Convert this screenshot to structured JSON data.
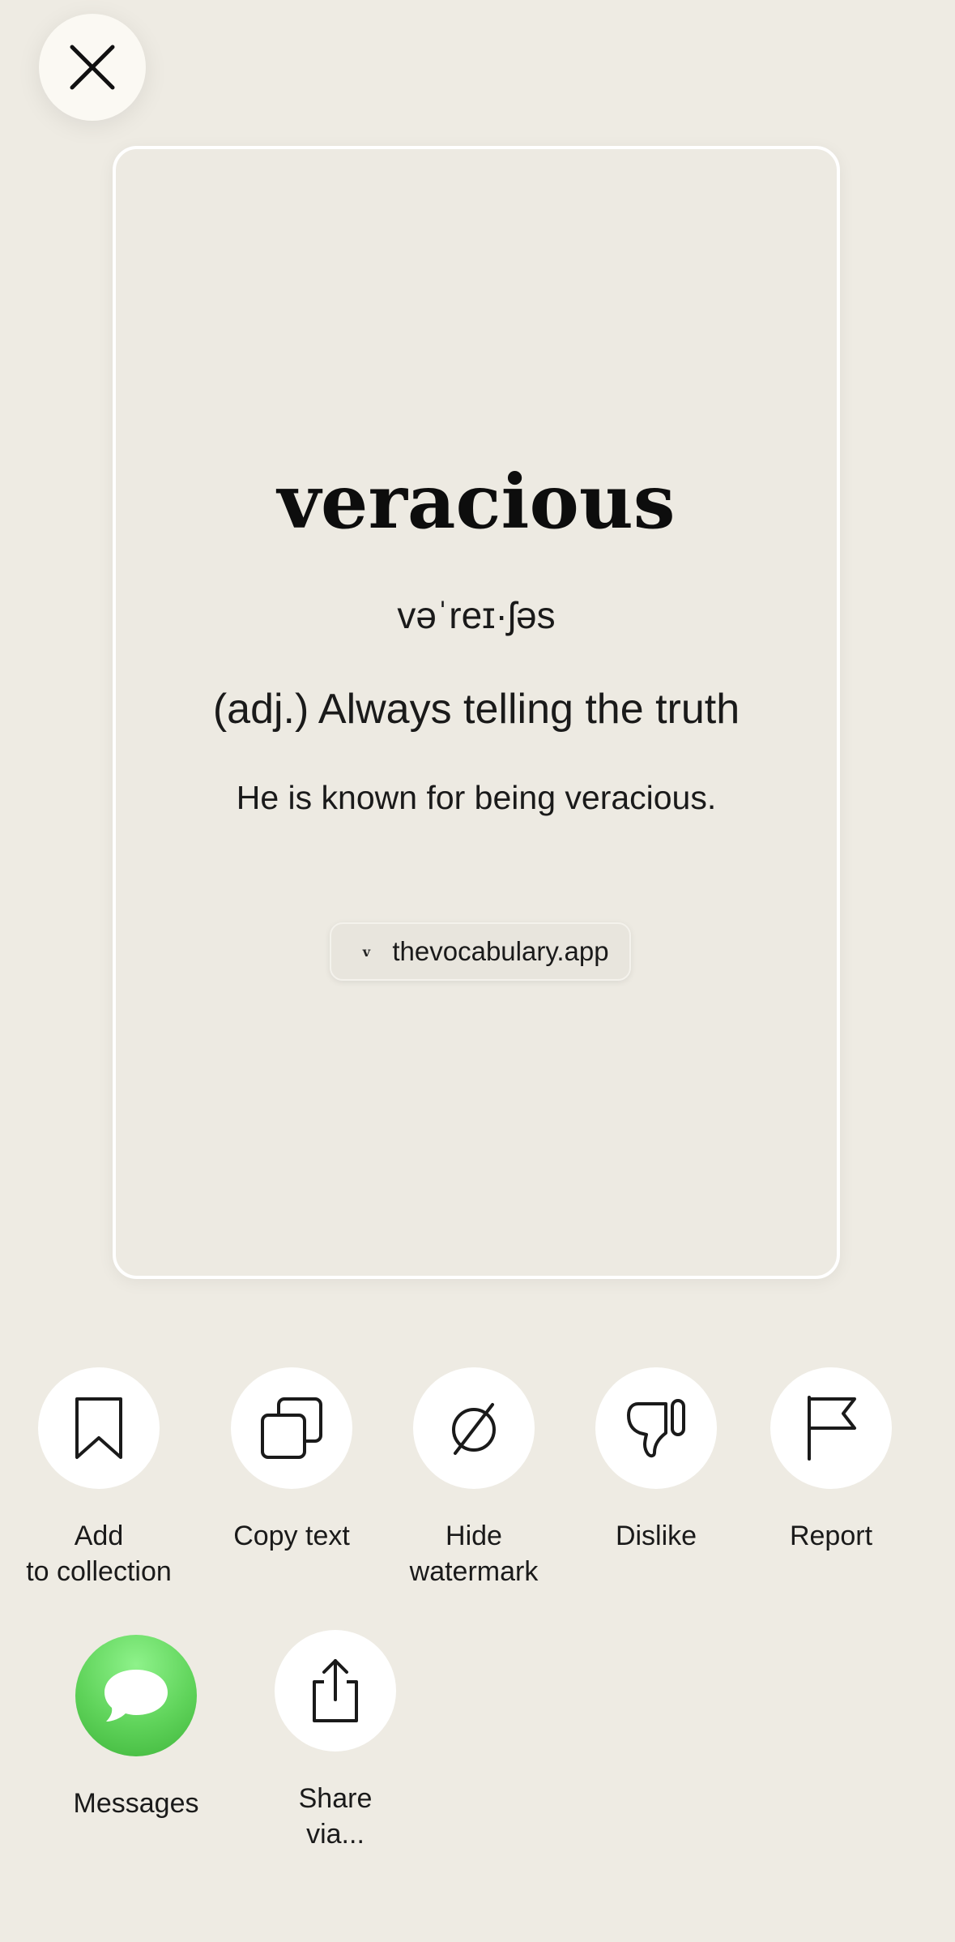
{
  "card": {
    "word": "veracious",
    "pronunciation": "vəˈreɪ·ʃəs",
    "definition": "(adj.) Always telling the truth",
    "example": "He is known for being veracious.",
    "watermark_logo": "v",
    "watermark_text": "thevocabulary.app"
  },
  "actions": {
    "add_collection": {
      "label": "Add\nto collection",
      "icon": "bookmark-icon"
    },
    "copy_text": {
      "label": "Copy text",
      "icon": "copy-icon"
    },
    "hide_watermark": {
      "label": "Hide\nwatermark",
      "icon": "hide-watermark-icon"
    },
    "dislike": {
      "label": "Dislike",
      "icon": "thumbs-down-icon"
    },
    "report": {
      "label": "Report",
      "icon": "flag-icon"
    },
    "messages": {
      "label": "Messages",
      "icon": "messages-icon"
    },
    "share_via": {
      "label": "Share\nvia...",
      "icon": "share-icon"
    }
  },
  "colors": {
    "background": "#eeebe3",
    "card": "#edeae2",
    "messages_green": "#5fd35a"
  }
}
